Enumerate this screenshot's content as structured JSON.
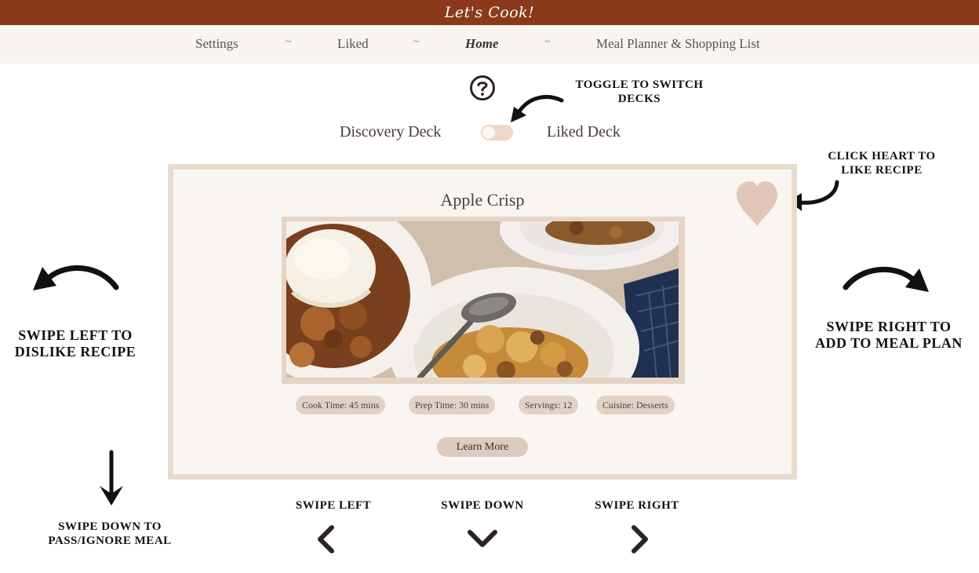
{
  "header": {
    "logo_text": "Let's Cook!",
    "bg_color": "#8a3a1b"
  },
  "nav": {
    "settings": "Settings",
    "sep": "~",
    "liked": "Liked",
    "home": "Home",
    "planner": "Meal Planner & Shopping List"
  },
  "help_icon": "question-circle-icon",
  "toggle": {
    "discovery_label": "Discovery Deck",
    "liked_label": "Liked Deck",
    "state": "off"
  },
  "annotations": {
    "toggle_hint": "TOGGLE TO SWITCH DECKS",
    "heart_hint": "CLICK HEART TO LIKE RECIPE",
    "left_hint": "SWIPE LEFT TO DISLIKE RECIPE",
    "right_hint": "SWIPE RIGHT TO ADD TO MEAL PLAN",
    "down_hint": "SWIPE DOWN TO PASS/IGNORE MEAL"
  },
  "recipe": {
    "title": "Apple Crisp",
    "image_alt": "apple-crisp-with-ice-cream-photo",
    "cook_time": "Cook Time: 45 mins",
    "prep_time": "Prep Time: 30 mins",
    "servings": "Servings: 12",
    "cuisine": "Cuisine: Desserts",
    "learn_more": "Learn More"
  },
  "swipe_controls": {
    "left": "SWIPE LEFT",
    "down": "SWIPE DOWN",
    "right": "SWIPE RIGHT"
  },
  "colors": {
    "card_border": "#e8dbcd",
    "pill": "#e2d2c6",
    "heart": "#e2c6ba"
  }
}
